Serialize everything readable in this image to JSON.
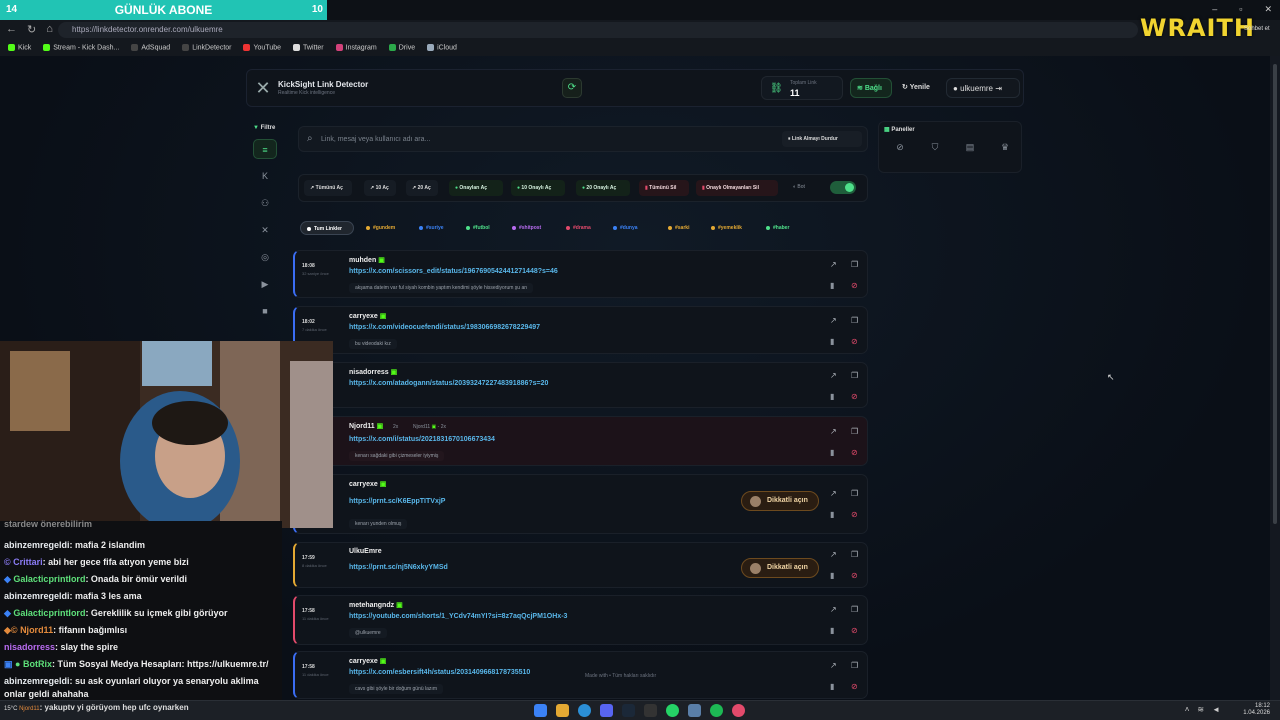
{
  "browser": {
    "sub_left": "14",
    "sub_title": "GÜNLÜK ABONE",
    "sub_right": "10",
    "url": "https://linkdetector.onrender.com/ulkuemre",
    "bookmarks": [
      "Kick",
      "Stream - Kick Dash...",
      "AdSquad",
      "LinkDetector",
      "YouTube",
      "Twitter",
      "Instagram",
      "Drive",
      "iCloud"
    ],
    "overlay_brand": "WRAITH",
    "chat_btn": "Sohbet et"
  },
  "app": {
    "name": "KickSight Link Detector",
    "subtitle": "Realtime Kick intelligence",
    "total_label": "Toplam Link",
    "total_value": "11",
    "status": "Bağlı",
    "refresh": "Yenile",
    "user": "ulkuemre",
    "filter_title": "Filtre",
    "search_placeholder": "Link, mesaj veya kullanıcı adı ara...",
    "stop_button": "Link Almayı Durdur",
    "actions": [
      "Tümünü Aç",
      "10 Aç",
      "20 Aç",
      "Onayları Aç",
      "10 Onaylı Aç",
      "20 Onaylı Aç",
      "Tümünü Sil",
      "Onaylı Olmayanları Sil"
    ],
    "bot_label": "Bot",
    "tags": [
      "Tum Linkler",
      "#gundem",
      "#suriye",
      "#futbol",
      "#shitpost",
      "#drama",
      "#dunya",
      "#sarki",
      "#yemeklik",
      "#haber"
    ],
    "panels_title": "Paneller",
    "cards": [
      {
        "time": "18:08",
        "ago": "32 saniye önce",
        "user": "muhden",
        "link": "https://x.com/scissors_edit/status/1967690542441271448?s=46",
        "msg": "akşama dateim var ful siyah kombin yaptım kendimi şöyle hissediyorum şu an"
      },
      {
        "time": "18:02",
        "ago": "7 dakika önce",
        "user": "carryexe",
        "link": "https://x.com/videocuefendi/status/1983066982678229497",
        "msg": "bu videodaki kız"
      },
      {
        "time": "",
        "ago": "",
        "user": "nisadorress",
        "link": "https://x.com/atadogann/status/2039324722748391886?s=20",
        "msg": ""
      },
      {
        "time": "",
        "ago": "",
        "user": "Njord11",
        "extra": "2x",
        "extra2": "Njord11",
        "extra3": "- 2x",
        "link": "https://x.com/i/status/2021831670106673434",
        "msg": "kenarı sağdaki gibi çizmeseler iyiymiş"
      },
      {
        "time": "",
        "ago": "",
        "user": "carryexe",
        "link": "https://prnt.sc/K6EppTITVxjP",
        "msg": "kenarı yunden olmuş",
        "warn": "Dikkatli açın"
      },
      {
        "time": "17:59",
        "ago": "8 dakika önce",
        "user": "UlkuEmre",
        "link": "https://prnt.sc/nj5N6xkyYMSd",
        "msg": "",
        "warn": "Dikkatli açın"
      },
      {
        "time": "17:58",
        "ago": "11 dakika önce",
        "user": "metehangndz",
        "link": "https://youtube.com/shorts/1_YCdv74mYI?si=8z7aqQcjPM1OHx-3",
        "msg": "@ulkuemre"
      },
      {
        "time": "17:58",
        "ago": "11 dakika önce",
        "user": "carryexe",
        "link": "https://x.com/esbersift4h/status/2031409668178735510",
        "msg": "cavs gibi şöyle bir doğum günü lazım"
      }
    ],
    "footer": "Made with  •  Tüm hakları saklıdır"
  },
  "chat": [
    {
      "name": "abinzemregeldi",
      "text": ": mafia 2 islandim",
      "color": "#e8ecf0"
    },
    {
      "name": "Crittari",
      "text": ": abi her gece fifa atıyon yeme bizi",
      "color": "#8b7cf6"
    },
    {
      "name": "GalacticprintIord",
      "text": ": Onada bir ömür verildi",
      "color": "#5ee07a"
    },
    {
      "name": "abinzemregeldi",
      "text": ": mafia 3 les ama",
      "color": "#e8ecf0"
    },
    {
      "name": "GalacticprintIord",
      "text": ": Gereklilik su içmek gibi görüyor",
      "color": "#5ee07a"
    },
    {
      "name": "Njord11",
      "text": ": fifanın bağımlısı",
      "color": "#e38a3c"
    },
    {
      "name": "nisadorress",
      "text": ": slay the spire",
      "color": "#b86cf0"
    },
    {
      "name": "BotRix",
      "text": ": Tüm Sosyal Medya Hesapları: https://ulkuemre.tr/",
      "color": "#5ee07a"
    },
    {
      "name": "abinzemregeldi",
      "text": ": su ask oyunlari oluyor ya senaryolu aklima",
      "color": "#e8ecf0"
    },
    {
      "name": "",
      "text": "onlar geldi ahahaha",
      "color": "#e8ecf0"
    },
    {
      "name": "Njord11",
      "text": ": yakuptv yi görüyom hep ufc oynarken",
      "color": "#e38a3c"
    }
  ],
  "chat_top": "stardew önerebilirim",
  "taskbar": {
    "weather": "15°C",
    "time": "18:12",
    "date": "1.04.2026"
  }
}
